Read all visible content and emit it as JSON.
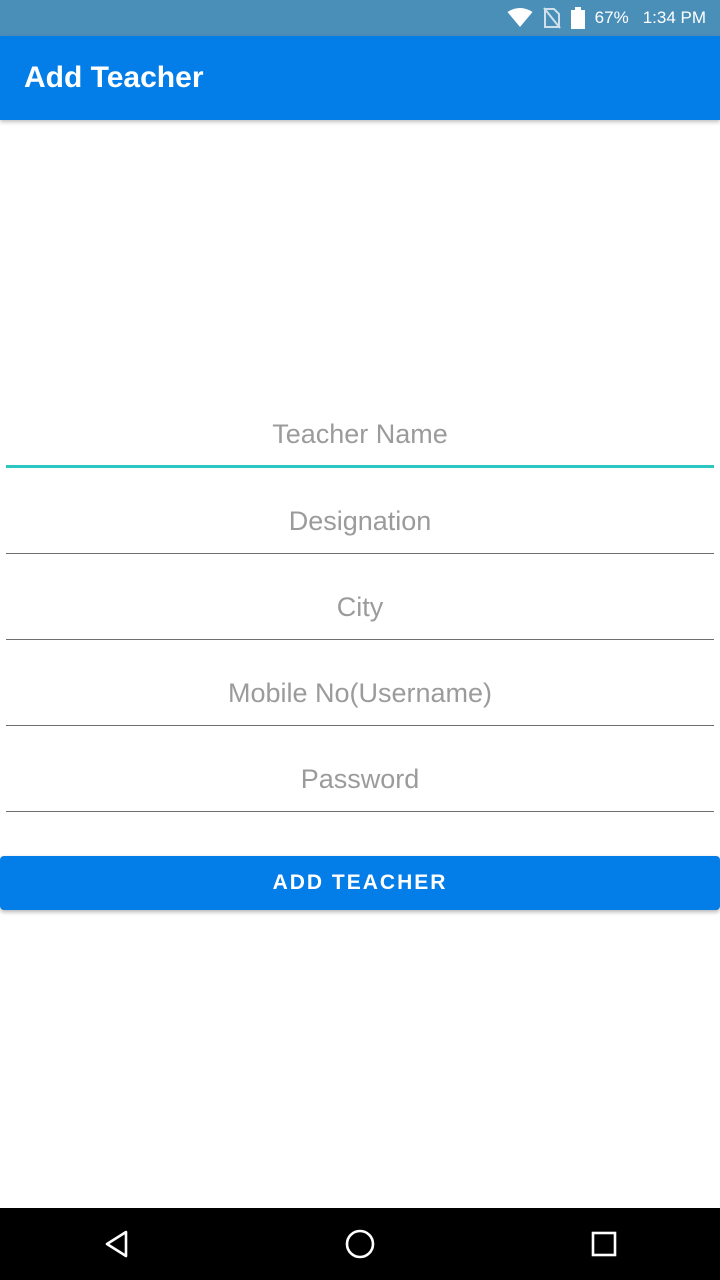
{
  "status_bar": {
    "battery": "67%",
    "time": "1:34 PM",
    "icons": [
      "wifi-icon",
      "no-sim-icon",
      "battery-icon"
    ]
  },
  "app_bar": {
    "title": "Add Teacher",
    "color": "#037de8"
  },
  "form": {
    "fields": [
      {
        "placeholder": "Teacher Name",
        "value": "",
        "focused": true
      },
      {
        "placeholder": "Designation",
        "value": ""
      },
      {
        "placeholder": "City",
        "value": ""
      },
      {
        "placeholder": "Mobile No(Username)",
        "value": ""
      },
      {
        "placeholder": "Password",
        "value": ""
      }
    ],
    "focus_color": "#2cc7c3"
  },
  "submit_button": {
    "label": "ADD TEACHER"
  },
  "nav_bar": {
    "icons": [
      "back-icon",
      "home-icon",
      "recents-icon"
    ]
  }
}
